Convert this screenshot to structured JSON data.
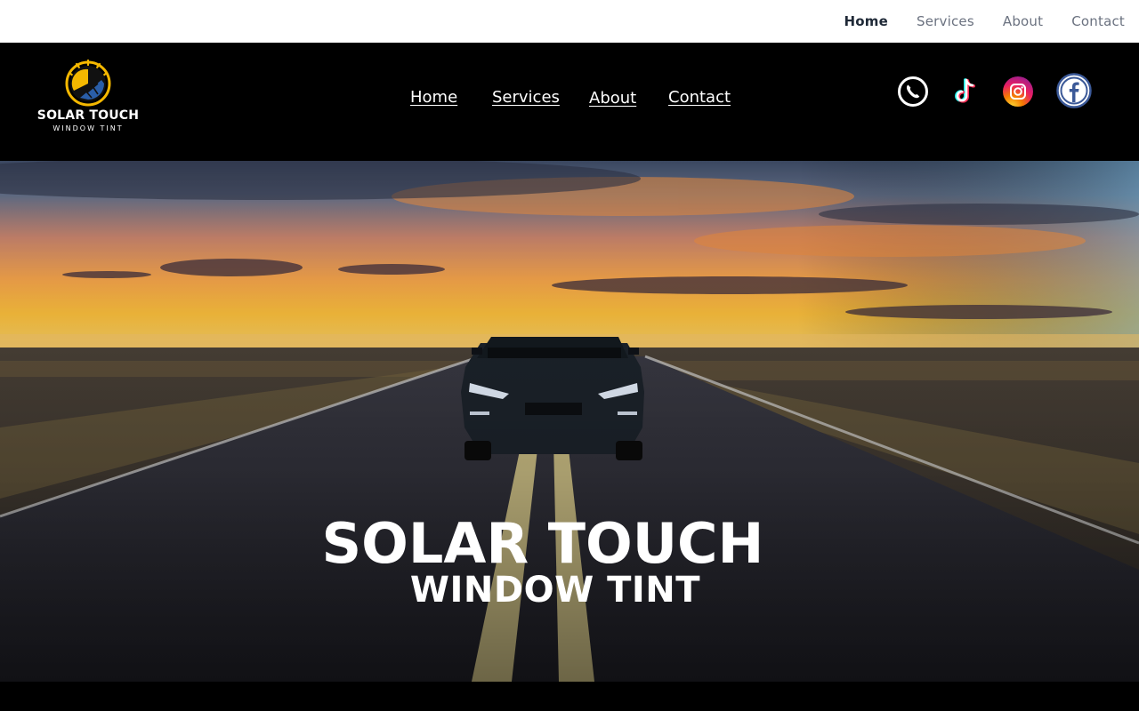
{
  "top_nav": {
    "items": [
      {
        "label": "Home",
        "active": true
      },
      {
        "label": "Services",
        "active": false
      },
      {
        "label": "About",
        "active": false
      },
      {
        "label": "Contact",
        "active": false
      }
    ]
  },
  "header": {
    "logo": {
      "title": "SOLAR TOUCH",
      "subtitle": "WINDOW TINT",
      "icon": "sun-window-logo-icon"
    },
    "nav": [
      {
        "label": "Home"
      },
      {
        "label": "Services"
      },
      {
        "label": "About"
      },
      {
        "label": "Contact"
      }
    ],
    "social": [
      {
        "icon": "phone-icon"
      },
      {
        "icon": "tiktok-icon"
      },
      {
        "icon": "instagram-icon"
      },
      {
        "icon": "facebook-icon"
      }
    ]
  },
  "hero": {
    "title": "SOLAR TOUCH",
    "subtitle": "WINDOW TINT",
    "image": "convertible-car-on-road-at-sunset"
  },
  "colors": {
    "header_bg": "#000000",
    "topbar_bg": "#ffffff",
    "logo_accent": "#f5b800",
    "logo_blue": "#2a5ea8",
    "facebook_blue": "#3b5998"
  }
}
